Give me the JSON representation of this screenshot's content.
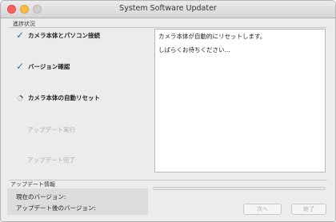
{
  "window": {
    "title": "System Software Updater"
  },
  "progress_section": {
    "label": "進捗状況",
    "steps": [
      {
        "label": "カメラ本体とパソコン接続",
        "state": "done",
        "icon": "checkmark-icon"
      },
      {
        "label": "バージョン確認",
        "state": "done",
        "icon": "checkmark-icon"
      },
      {
        "label": "カメラ本体の自動リセット",
        "state": "in-progress",
        "icon": "spinner-icon"
      },
      {
        "label": "アップデート実行",
        "state": "pending"
      },
      {
        "label": "アップデート完了",
        "state": "pending"
      }
    ]
  },
  "log": {
    "lines": [
      "カメラ本体が自動的にリセットします。",
      "しばらくお待ちください…"
    ]
  },
  "update_info": {
    "label": "アップデート情報",
    "current_version_label": "現在のバージョン:",
    "after_update_version_label": "アップデート後のバージョン:"
  },
  "progress_bar": {
    "value": 0
  },
  "buttons": {
    "next_label": "次へ",
    "finish_label": "終了"
  },
  "colors": {
    "checkmark": "#2f6fb8",
    "pending_text": "#ababab",
    "disabled_button_text": "#a9a9a9",
    "close_button": "#fc605c",
    "minimize_button": "#fdbc40",
    "zoom_button": "#cfcfcf"
  }
}
